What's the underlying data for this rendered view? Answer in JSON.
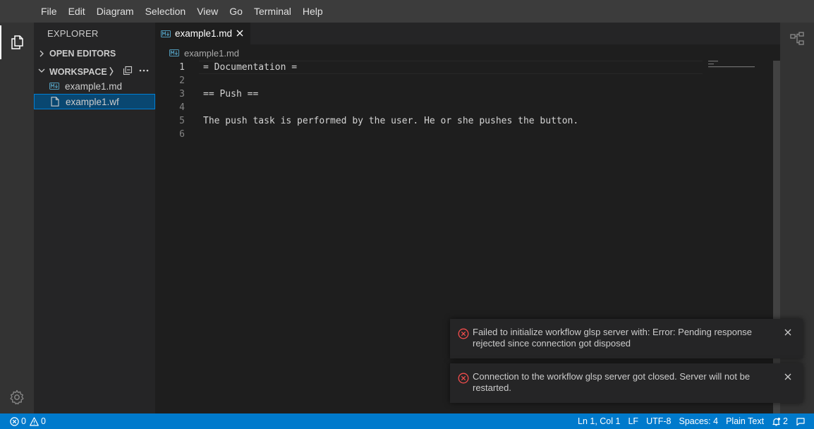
{
  "menubar": {
    "items": [
      "File",
      "Edit",
      "Diagram",
      "Selection",
      "View",
      "Go",
      "Terminal",
      "Help"
    ]
  },
  "sidebar": {
    "title": "EXPLORER",
    "open_editors_label": "OPEN EDITORS",
    "workspace_label": "WORKSPACE 〉",
    "files": [
      "example1.md",
      "example1.wf"
    ]
  },
  "editor": {
    "tab_label": "example1.md",
    "breadcrumb": "example1.md",
    "lines": [
      {
        "num": "1",
        "text": "= Documentation ="
      },
      {
        "num": "2",
        "text": ""
      },
      {
        "num": "3",
        "text": "== Push =="
      },
      {
        "num": "4",
        "text": ""
      },
      {
        "num": "5",
        "text": "The push task is performed by the user. He or she pushes the button."
      },
      {
        "num": "6",
        "text": ""
      }
    ]
  },
  "notifications": [
    {
      "message": "Failed to initialize workflow glsp server with: Error: Pending response rejected since connection got disposed"
    },
    {
      "message": "Connection to the workflow glsp server got closed. Server will not be restarted."
    }
  ],
  "statusbar": {
    "errors": "0",
    "warnings": "0",
    "position": "Ln 1, Col 1",
    "eol": "LF",
    "encoding": "UTF-8",
    "indent": "Spaces: 4",
    "language": "Plain Text",
    "notification_count": "2"
  },
  "colors": {
    "accent": "#007acc",
    "selection": "#094771",
    "error": "#f14c4c"
  }
}
